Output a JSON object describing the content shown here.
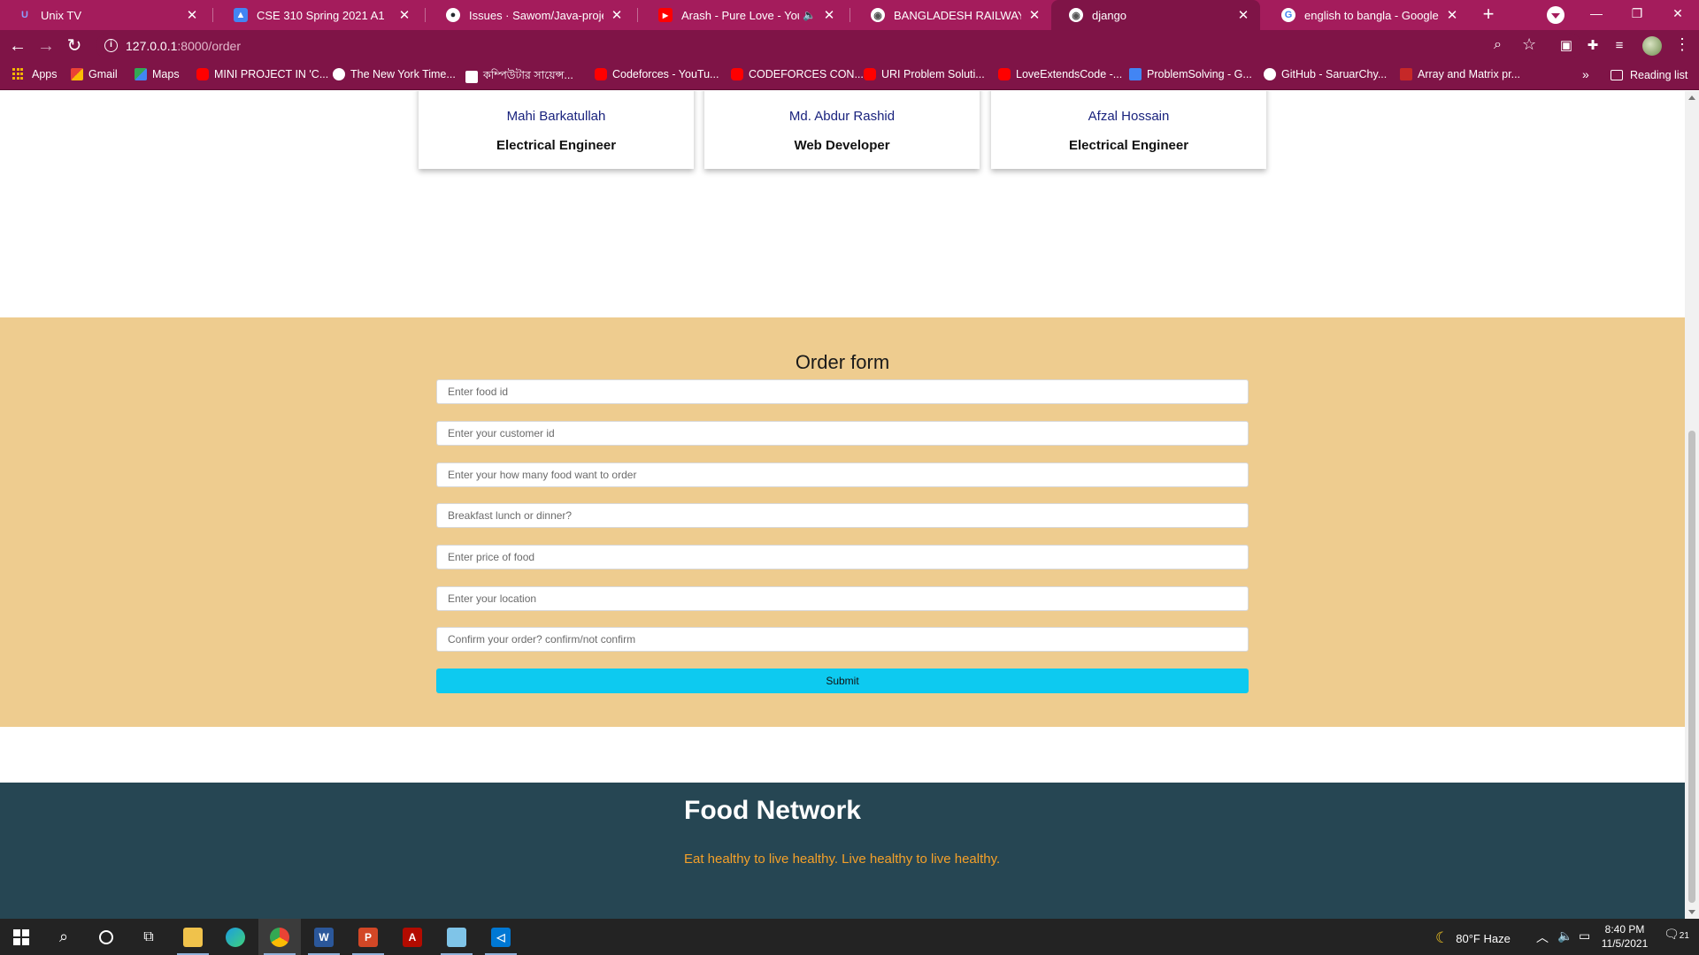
{
  "browser": {
    "tabs": [
      {
        "title": "Unix TV",
        "favicon": "U",
        "favicon_color": "#5c6bc0",
        "close": "✕"
      },
      {
        "title": "CSE 310 Spring 2021 A1",
        "favicon": "▲",
        "favicon_color": "#4285f4",
        "close": "✕"
      },
      {
        "title": "Issues · Sawom/Java-project",
        "favicon": "●",
        "favicon_color": "#24292e",
        "close": "✕"
      },
      {
        "title": "Arash - Pure Love - YouTube",
        "favicon": "▶",
        "favicon_color": "#ff0000",
        "close": "✕"
      },
      {
        "title": "BANGLADESH RAILWAY E-TICKE",
        "favicon": "◉",
        "favicon_color": "#555555",
        "close": "✕"
      },
      {
        "title": "django",
        "favicon": "◉",
        "favicon_color": "#555555",
        "close": "✕"
      },
      {
        "title": "english to bangla - Google Sear",
        "favicon": "G",
        "favicon_color": "#4285f4",
        "close": "✕"
      }
    ],
    "active_tab": 5,
    "new_tab_label": "+",
    "url_host": "127.0.0.1",
    "url_path": ":8000/order",
    "bookmarks": [
      {
        "label": "Apps",
        "icon": "apps-grid-icon",
        "color": "#f4b400"
      },
      {
        "label": "Gmail",
        "icon": "gmail-icon",
        "color": "#ea4335"
      },
      {
        "label": "Maps",
        "icon": "maps-icon",
        "color": "#34a853"
      },
      {
        "label": "MINI PROJECT IN 'C...",
        "icon": "youtube-icon",
        "color": "#ff0000"
      },
      {
        "label": "The New York Time...",
        "icon": "globe-icon",
        "color": "#ffffff"
      },
      {
        "label": "কম্পিউটার সায়েন্স...",
        "icon": "h-icon",
        "color": "#ffffff"
      },
      {
        "label": "Codeforces - YouTu...",
        "icon": "youtube-icon",
        "color": "#ff0000"
      },
      {
        "label": "CODEFORCES CON...",
        "icon": "youtube-icon",
        "color": "#ff0000"
      },
      {
        "label": "URI Problem Soluti...",
        "icon": "youtube-icon",
        "color": "#ff0000"
      },
      {
        "label": "LoveExtendsCode -...",
        "icon": "youtube-icon",
        "color": "#ff0000"
      },
      {
        "label": "ProblemSolving - G...",
        "icon": "docs-icon",
        "color": "#4285f4"
      },
      {
        "label": "GitHub - SaruarChy...",
        "icon": "github-icon",
        "color": "#ffffff"
      },
      {
        "label": "Array and Matrix pr...",
        "icon": "bookmark-icon",
        "color": "#c62828"
      }
    ],
    "bookmarks_more": "»",
    "reading_list": "Reading list"
  },
  "team": [
    {
      "name": "Mahi Barkatullah",
      "role": "Electrical Engineer"
    },
    {
      "name": "Md. Abdur Rashid",
      "role": "Web Developer"
    },
    {
      "name": "Afzal Hossain",
      "role": "Electrical Engineer"
    }
  ],
  "order_form": {
    "title": "Order form",
    "fields": [
      {
        "name": "food-id-input",
        "placeholder": "Enter food id"
      },
      {
        "name": "customer-id-input",
        "placeholder": "Enter your customer id"
      },
      {
        "name": "quantity-input",
        "placeholder": "Enter your how many food want to order"
      },
      {
        "name": "meal-type-input",
        "placeholder": "Breakfast lunch or dinner?"
      },
      {
        "name": "price-input",
        "placeholder": "Enter price of food"
      },
      {
        "name": "location-input",
        "placeholder": "Enter your location"
      },
      {
        "name": "confirm-input",
        "placeholder": "Confirm your order? confirm/not confirm"
      }
    ],
    "submit_label": "Submit"
  },
  "footer": {
    "brand": "Food Network",
    "tagline": "Eat healthy to live healthy. Live healthy to live healthy."
  },
  "taskbar": {
    "weather": "80°F  Haze",
    "time": "8:40 PM",
    "date": "11/5/2021",
    "notification_count": "21"
  },
  "colors": {
    "chrome_frame": "#a41c5c",
    "chrome_toolbar": "#7f1447",
    "order_section_bg": "#eecc8f",
    "submit_bg": "#0dcaf0",
    "footer_bg": "#264653",
    "tagline": "#f4a029",
    "member_name": "#1a237e"
  }
}
